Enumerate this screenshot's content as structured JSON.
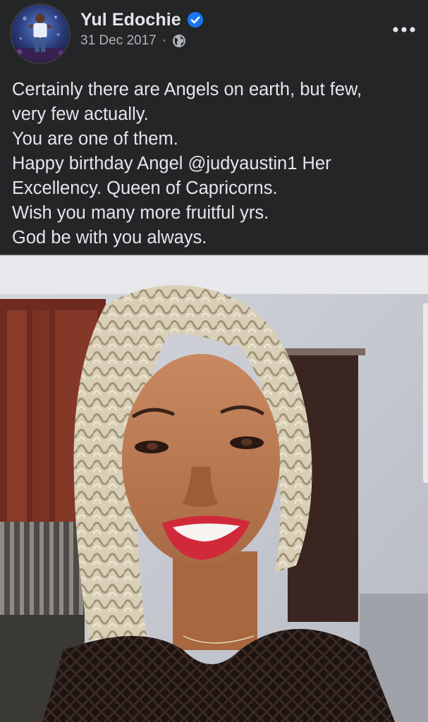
{
  "post": {
    "author": {
      "name": "Yul Edochie",
      "verified": true,
      "avatar_icon": "profile-photo"
    },
    "meta": {
      "date": "31 Dec 2017",
      "separator": "·",
      "privacy_icon": "globe-icon"
    },
    "more_icon": "more-horizontal-icon",
    "caption_lines": [
      "Certainly there are Angels on earth, but few,",
      "very few actually.",
      "You are one of them.",
      "Happy birthday Angel @judyaustin1 Her",
      "Excellency. Queen of Capricorns.",
      "Wish you many more fruitful yrs.",
      "God be with you always."
    ],
    "photo": {
      "subject": "selfie-photo"
    }
  },
  "colors": {
    "background": "#242526",
    "text_primary": "#e4e6eb",
    "text_secondary": "#b0b3b8",
    "verified_badge": "#1877f2"
  }
}
